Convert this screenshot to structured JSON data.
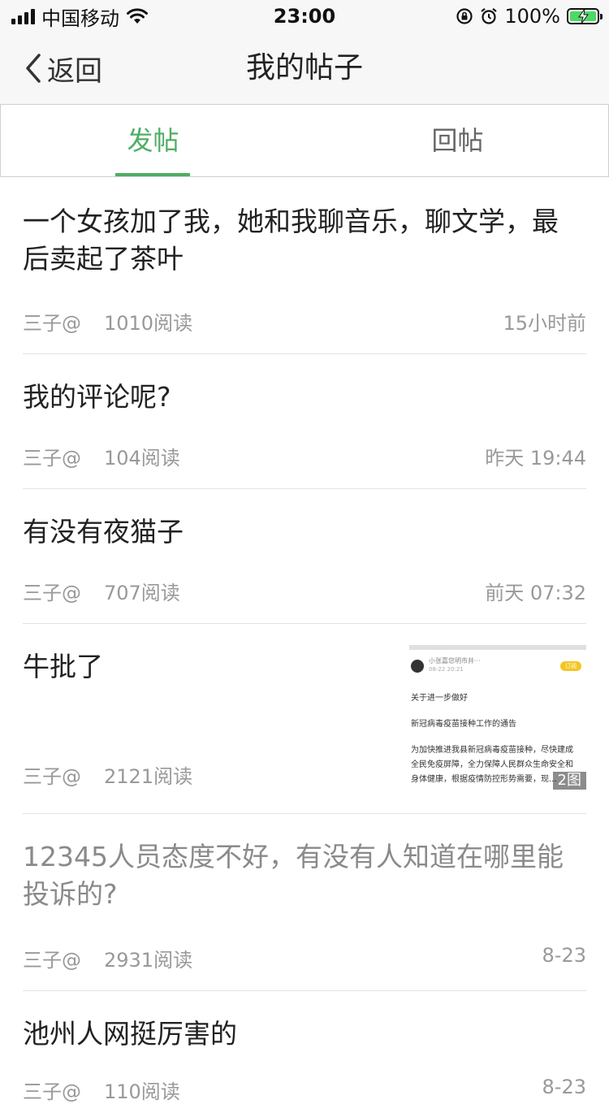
{
  "status_bar": {
    "carrier": "中国移动",
    "time": "23:00",
    "battery": "100%"
  },
  "nav": {
    "back_label": "返回",
    "title": "我的帖子"
  },
  "tabs": [
    {
      "label": "发帖",
      "active": true
    },
    {
      "label": "回帖",
      "active": false
    }
  ],
  "posts": [
    {
      "title_line1": "一个女孩加了我，她和我聊音乐，聊文学，最",
      "title_line2": "后卖起了茶叶",
      "author": "三子@",
      "reads": "1010阅读",
      "time": "15小时前"
    },
    {
      "title_line1": "我的评论呢?",
      "author": "三子@",
      "reads": "104阅读",
      "time": "昨天 19:44"
    },
    {
      "title_line1": "有没有夜猫子",
      "author": "三子@",
      "reads": "707阅读",
      "time": "前天 07:32"
    },
    {
      "title_line1": "牛批了",
      "author": "三子@",
      "reads": "2121阅读",
      "time": "",
      "thumbnail": {
        "user": "小张嘉您明市井···",
        "date": "08-22 20:21",
        "badge": "订阅",
        "lines": [
          "关于进一步做好",
          "新冠病毒疫苗接种工作的通告",
          "为加快推进我县新冠病毒疫苗接种，尽快建成",
          "全民免疫屏障，全力保障人民群众生命安全和",
          "身体健康，根据疫情防控形势需要，现..."
        ],
        "count": "2图"
      }
    },
    {
      "title_line1": "12345人员态度不好，有没有人知道在哪里能",
      "title_line2": "投诉的?",
      "author": "三子@",
      "reads": "2931阅读",
      "time": "8-23",
      "muted": true
    },
    {
      "title_line1": "池州人网挺厉害的",
      "author": "三子@",
      "reads": "110阅读",
      "time": "8-23"
    }
  ]
}
